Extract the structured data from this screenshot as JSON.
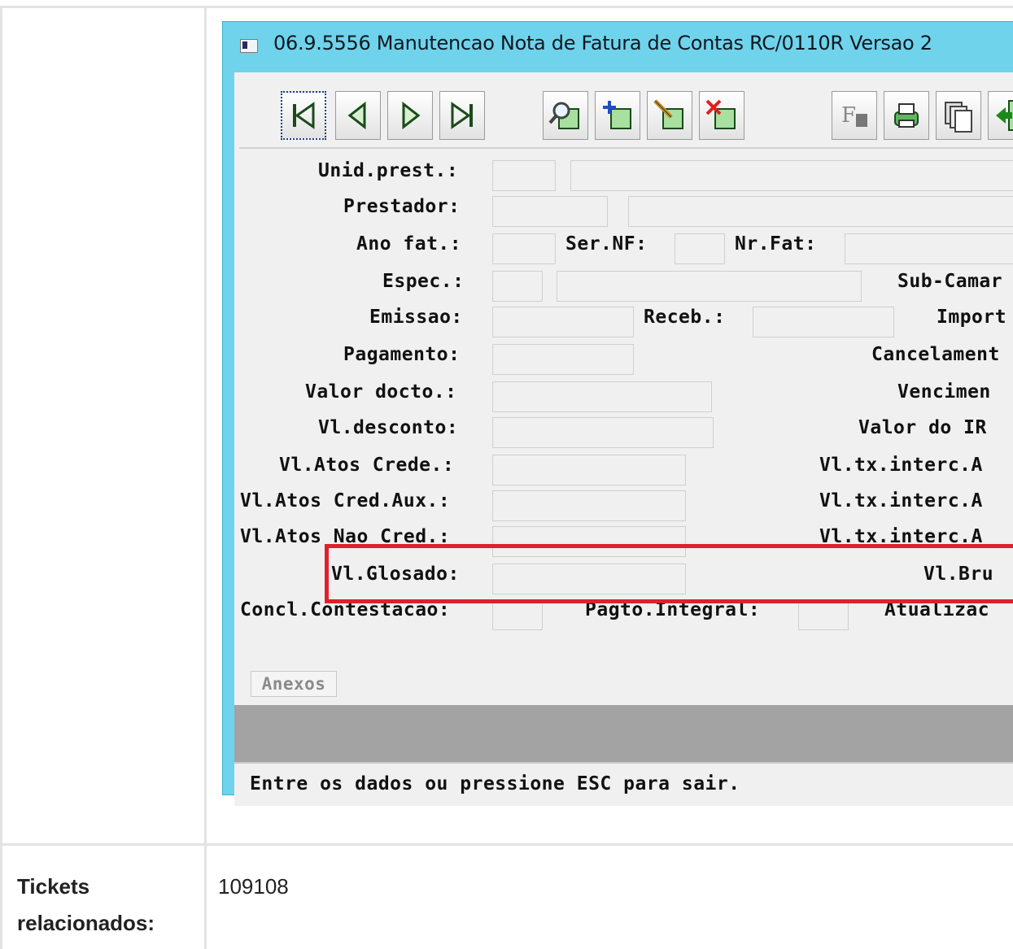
{
  "window": {
    "title": "06.9.5556 Manutencao  Nota de Fatura de Contas RC/0110R Versao 2"
  },
  "toolbar": {
    "buttons": [
      {
        "name": "first-record-button",
        "icon": "first-record-icon"
      },
      {
        "name": "previous-record-button",
        "icon": "previous-record-icon"
      },
      {
        "name": "next-record-button",
        "icon": "next-record-icon"
      },
      {
        "name": "last-record-button",
        "icon": "last-record-icon"
      },
      {
        "name": "search-button",
        "icon": "magnifier-icon"
      },
      {
        "name": "add-record-button",
        "icon": "add-icon"
      },
      {
        "name": "edit-record-button",
        "icon": "edit-pencil-icon"
      },
      {
        "name": "delete-record-button",
        "icon": "delete-x-icon"
      },
      {
        "name": "formula-button",
        "icon": "formula-f-icon"
      },
      {
        "name": "print-button",
        "icon": "printer-icon"
      },
      {
        "name": "copy-button",
        "icon": "copy-pages-icon"
      },
      {
        "name": "exit-button",
        "icon": "exit-door-icon"
      }
    ]
  },
  "form": {
    "unid_prest": "Unid.prest.:",
    "prestador": "Prestador:",
    "ano_fat": "Ano fat.:",
    "ser_nf": "Ser.NF:",
    "nr_fat": "Nr.Fat:",
    "espec": "Espec.:",
    "sub_camar": "Sub-Camar",
    "emissao": "Emissao:",
    "receb": "Receb.:",
    "import": "Import",
    "pagamento": "Pagamento:",
    "cancelament": "Cancelament",
    "valor_docto": "Valor docto.:",
    "vencimen": "Vencimen",
    "vl_desconto": "Vl.desconto:",
    "valor_do_ir": "Valor do IR",
    "vl_atos_crede": "Vl.Atos Crede.:",
    "vl_tx_interc_1": "Vl.tx.interc.A",
    "vl_atos_cred_aux": "Vl.Atos Cred.Aux.:",
    "vl_tx_interc_2": "Vl.tx.interc.A",
    "vl_atos_nao_cred": "Vl.Atos Nao Cred.:",
    "vl_tx_interc_3": "Vl.tx.interc.A",
    "vl_glosado": "Vl.Glosado:",
    "vl_bru": "Vl.Bru",
    "concl_contestacao": "Concl.Contestacao:",
    "pagto_integral": "Pagto.Integral:",
    "atualizac": "Atualizac"
  },
  "anexos_label": "Anexos",
  "status_text": "Entre os dados ou pressione ESC para sair.",
  "tickets": {
    "label": "Tickets relacionados:",
    "value": "109108"
  },
  "colors": {
    "window_border": "#6fd3ec",
    "highlight": "#e0202a"
  }
}
